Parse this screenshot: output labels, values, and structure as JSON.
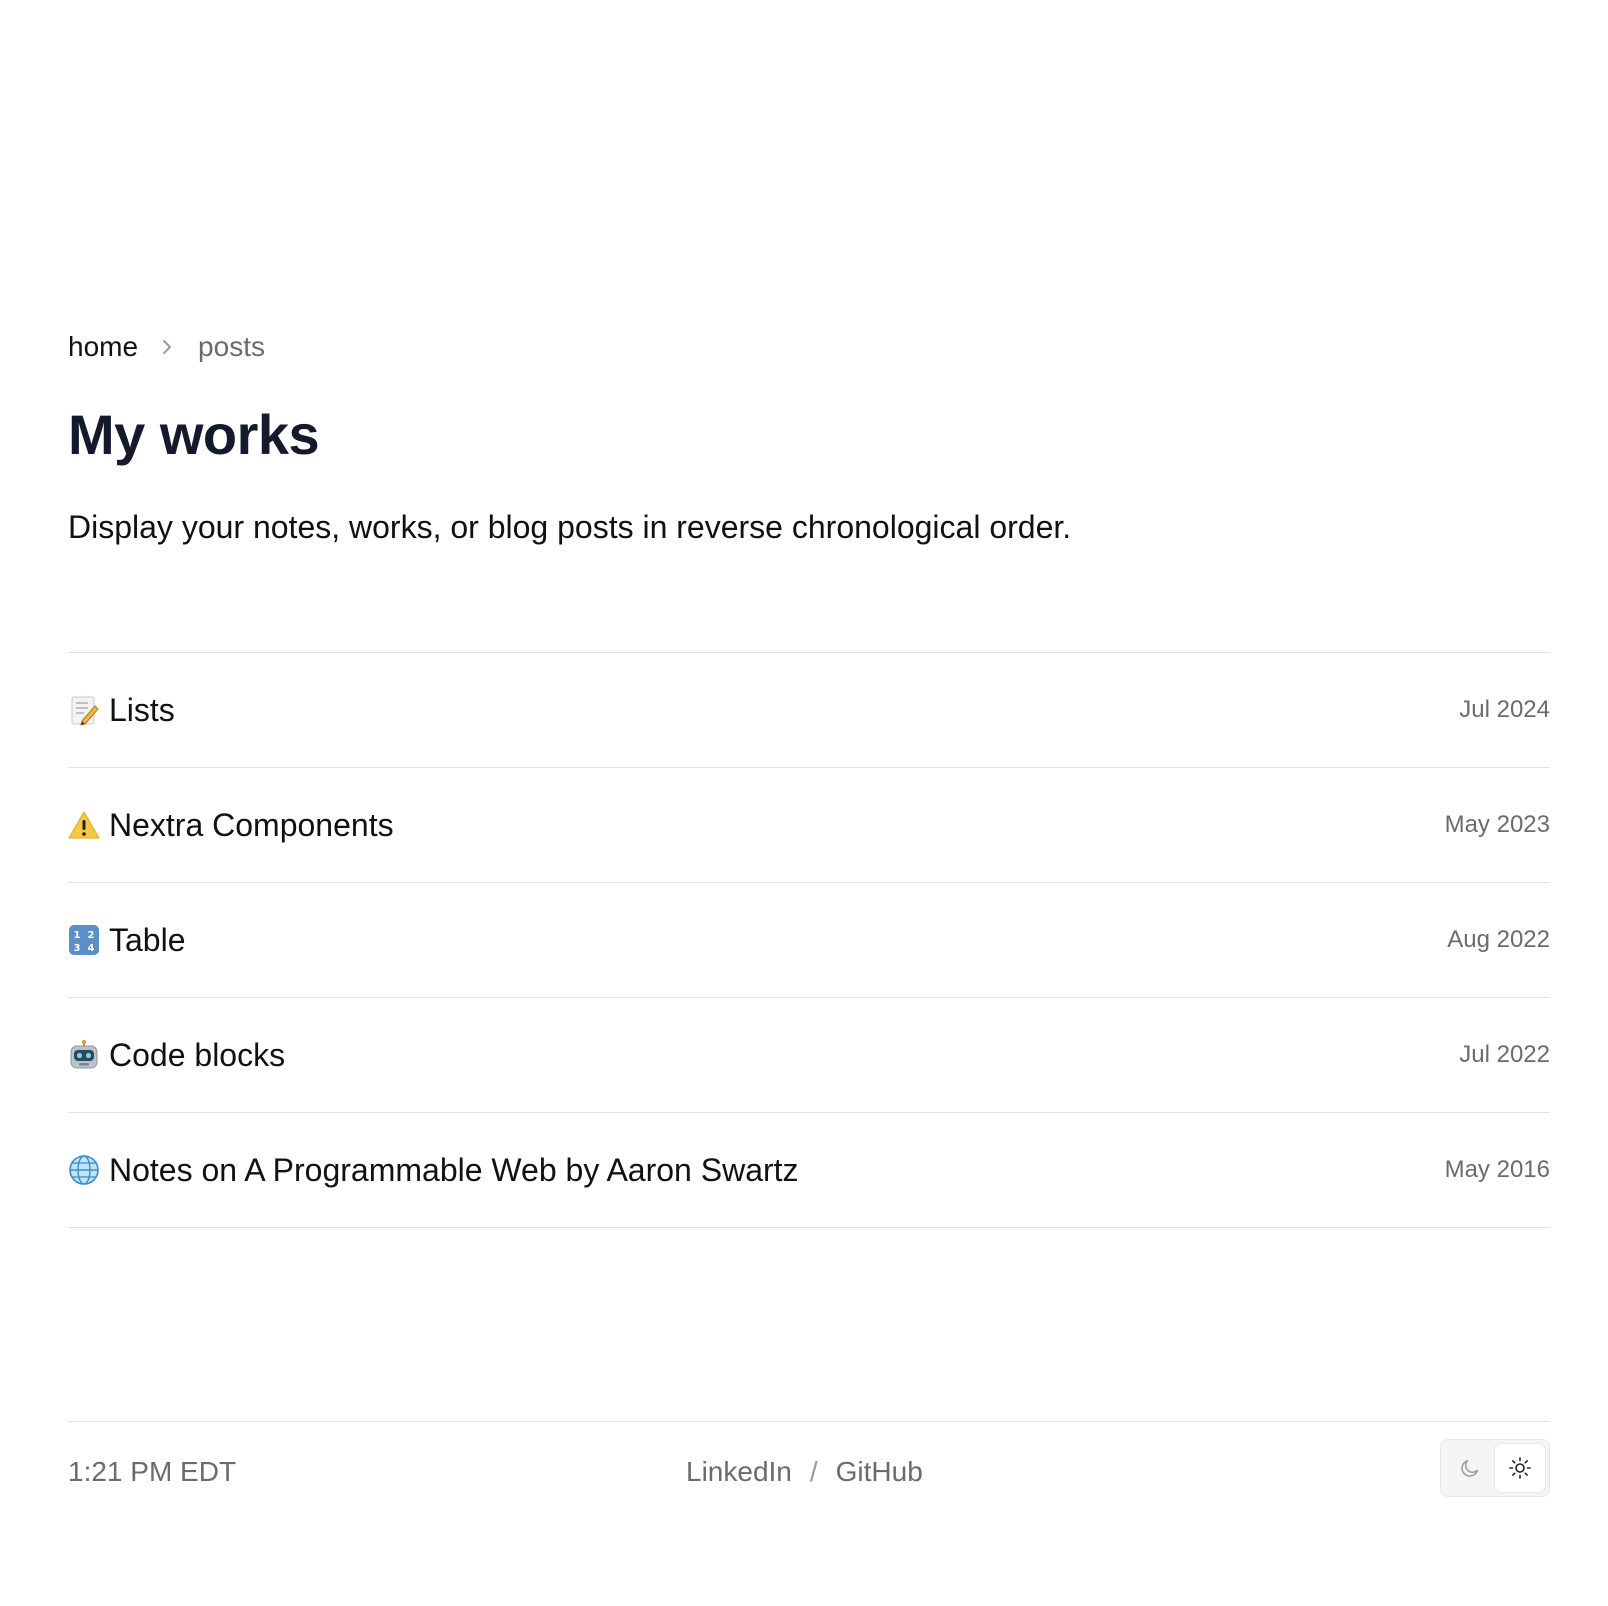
{
  "breadcrumb": {
    "home": "home",
    "current": "posts"
  },
  "page": {
    "title": "My works",
    "subtitle": "Display your notes, works, or blog posts in reverse chronological order."
  },
  "posts": [
    {
      "icon": "memo-icon",
      "title": "Lists",
      "date": "Jul 2024"
    },
    {
      "icon": "warning-icon",
      "title": "Nextra Components",
      "date": "May 2023"
    },
    {
      "icon": "numbers-icon",
      "title": "Table",
      "date": "Aug 2022"
    },
    {
      "icon": "robot-icon",
      "title": "Code blocks",
      "date": "Jul 2022"
    },
    {
      "icon": "globe-icon",
      "title": "Notes on A Programmable Web by Aaron Swartz",
      "date": "May 2016"
    }
  ],
  "footer": {
    "time": "1:21 PM EDT",
    "links": {
      "linkedin": "LinkedIn",
      "separator": "/",
      "github": "GitHub"
    },
    "theme": {
      "selected": "light"
    }
  },
  "colors": {
    "text": "#111111",
    "heading": "#141a2b",
    "muted": "#6b6b6b",
    "border": "#e2e2e2"
  }
}
